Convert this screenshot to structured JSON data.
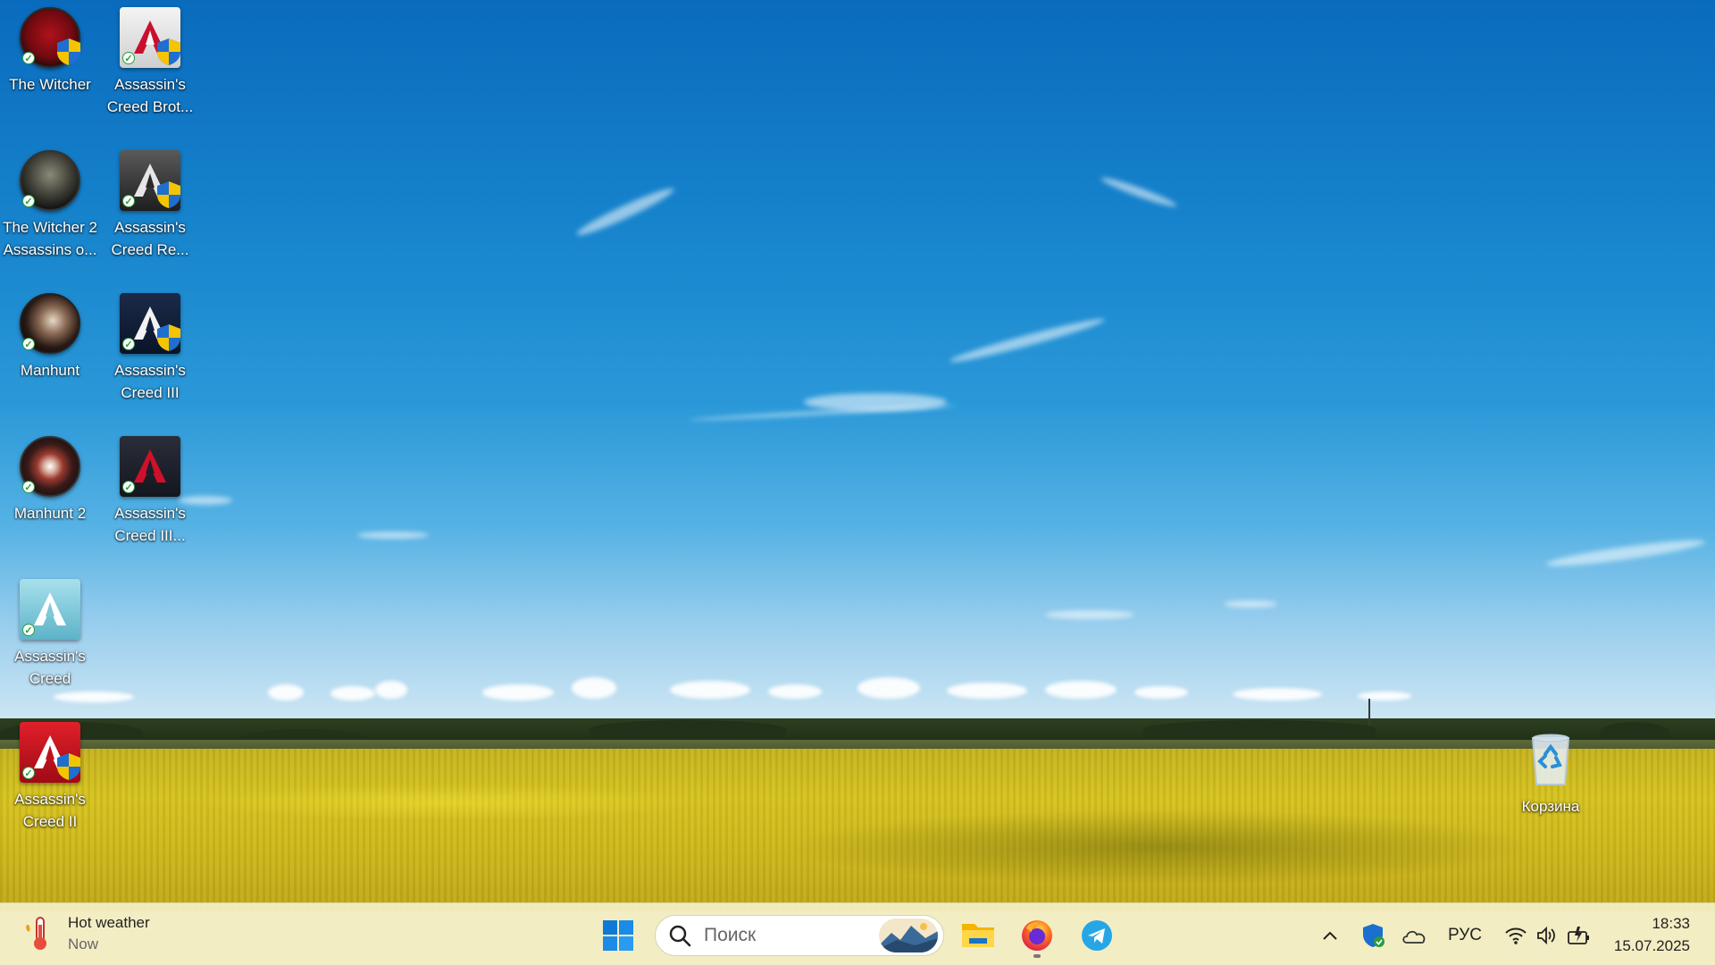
{
  "desktop": {
    "icons": [
      {
        "label": "The Witcher",
        "icon": "the-witcher-game-icon"
      },
      {
        "label": "Assassin's Creed Brot...",
        "icon": "assassins-creed-brotherhood-icon"
      },
      {
        "label": "The Witcher 2 Assassins o...",
        "icon": "the-witcher-2-icon"
      },
      {
        "label": "Assassin's Creed Re...",
        "icon": "assassins-creed-revelations-icon"
      },
      {
        "label": "Manhunt",
        "icon": "manhunt-icon"
      },
      {
        "label": "Assassin's Creed III",
        "icon": "assassins-creed-3-icon"
      },
      {
        "label": "Manhunt 2",
        "icon": "manhunt-2-icon"
      },
      {
        "label": "Assassin's Creed III...",
        "icon": "assassins-creed-3-remastered-icon"
      },
      {
        "label": "Assassin's Creed",
        "icon": "assassins-creed-icon"
      },
      {
        "label": "Assassin's Creed II",
        "icon": "assassins-creed-2-icon"
      },
      {
        "label": "Корзина",
        "icon": "recycle-bin-icon"
      }
    ]
  },
  "taskbar": {
    "weather": {
      "title": "Hot weather",
      "subtitle": "Now",
      "icon": "thermometer-icon"
    },
    "search": {
      "placeholder": "Поиск",
      "icon": "search-icon"
    },
    "apps": [
      {
        "name": "Windows Start",
        "icon": "windows-start-icon"
      },
      {
        "name": "File Explorer",
        "icon": "file-explorer-icon"
      },
      {
        "name": "Firefox",
        "icon": "firefox-icon",
        "running": true
      },
      {
        "name": "Telegram",
        "icon": "telegram-icon"
      }
    ],
    "tray": {
      "language": "РУС",
      "icons": [
        "chevron-up-icon",
        "windows-security-icon",
        "onedrive-cloud-icon",
        "wifi-icon",
        "volume-icon",
        "battery-charging-icon"
      ]
    },
    "clock": {
      "time": "18:33",
      "date": "15.07.2025"
    }
  },
  "colors": {
    "taskbar_bg": "#f3ecc1",
    "sky": "#1683cc",
    "field": "#d6c31e",
    "ac_red": "#c8102e"
  }
}
